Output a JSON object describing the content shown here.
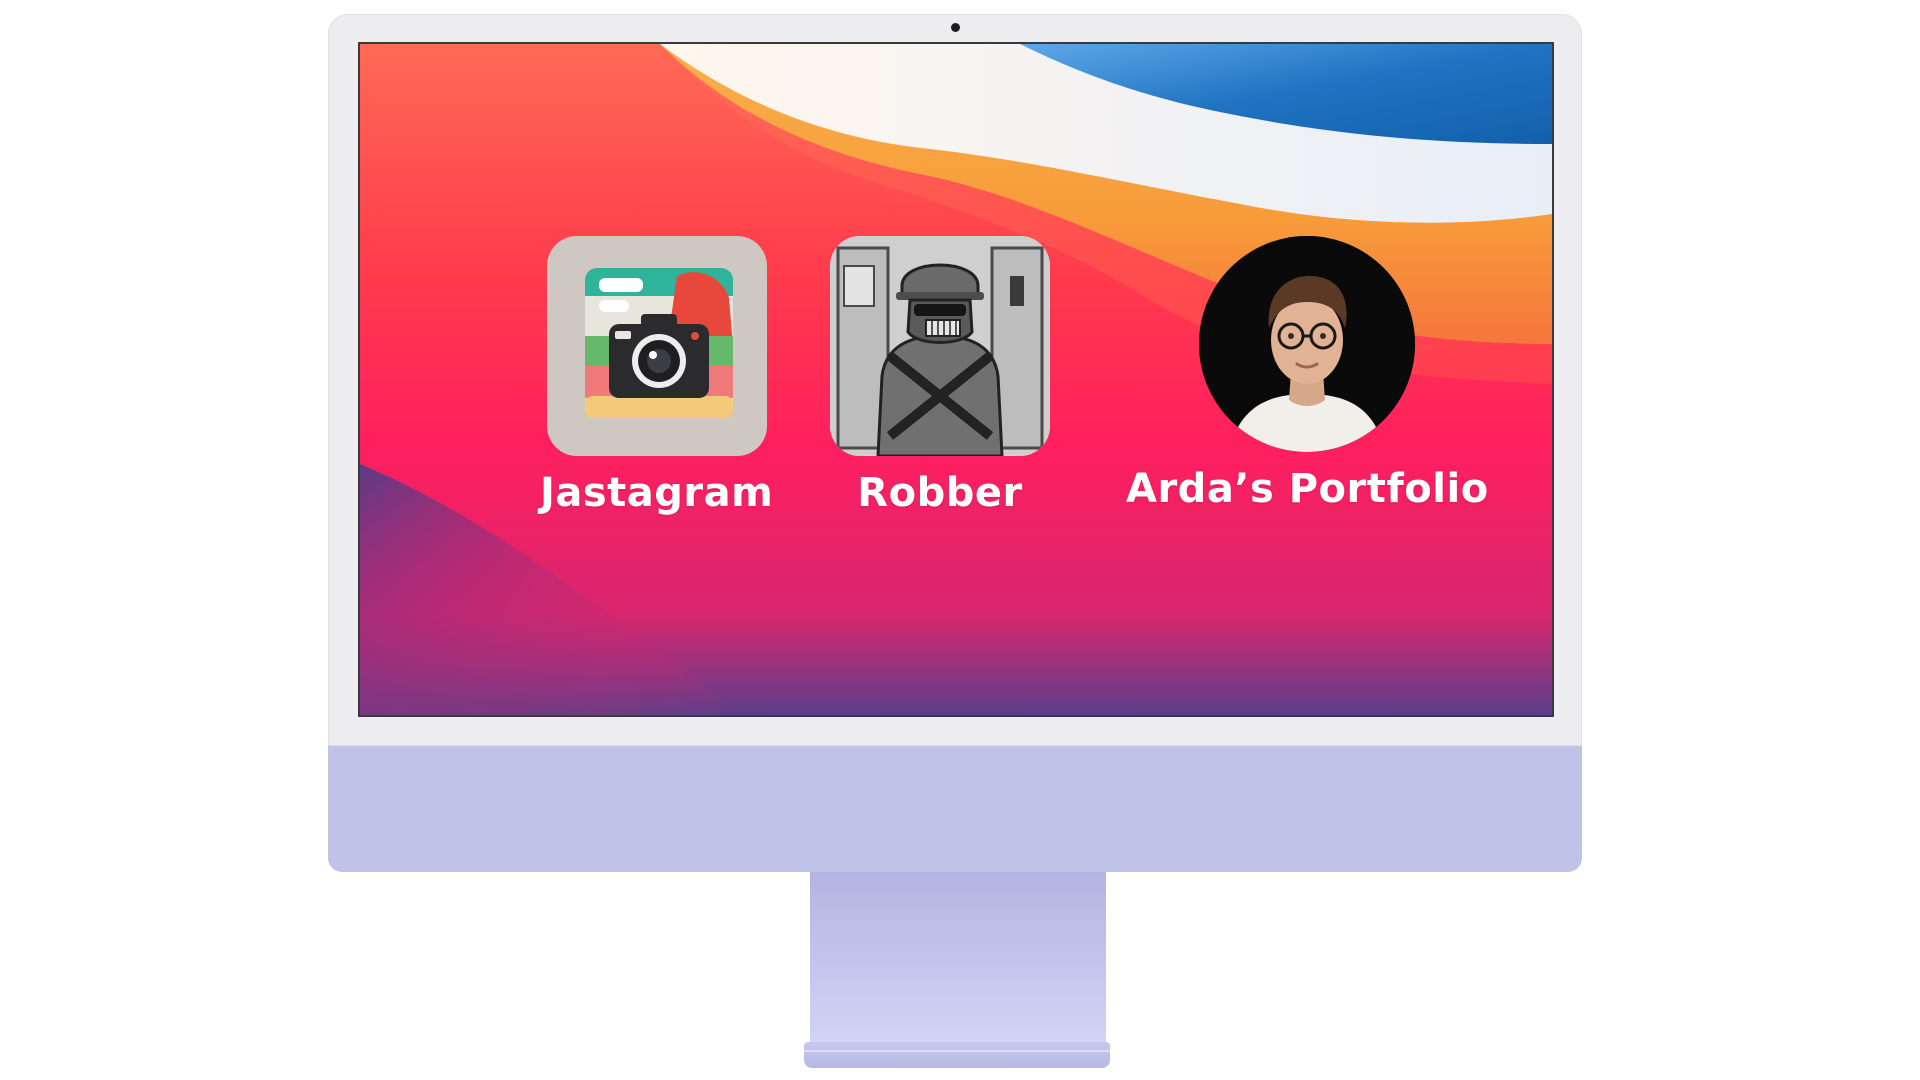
{
  "desktop": {
    "items": [
      {
        "label": "Jastagram",
        "icon": "camera-app-icon"
      },
      {
        "label": "Robber",
        "icon": "robber-app-icon"
      },
      {
        "label": "Arda’s Portfolio",
        "icon": "profile-photo-avatar"
      }
    ]
  },
  "colors": {
    "monitor_frame": "#ededf0",
    "monitor_chin": "#c0c3e8",
    "wallpaper_red": "#ff2b59",
    "wallpaper_orange": "#f6a23e",
    "wallpaper_blue": "#1c74c4",
    "label_text": "#ffffff"
  }
}
